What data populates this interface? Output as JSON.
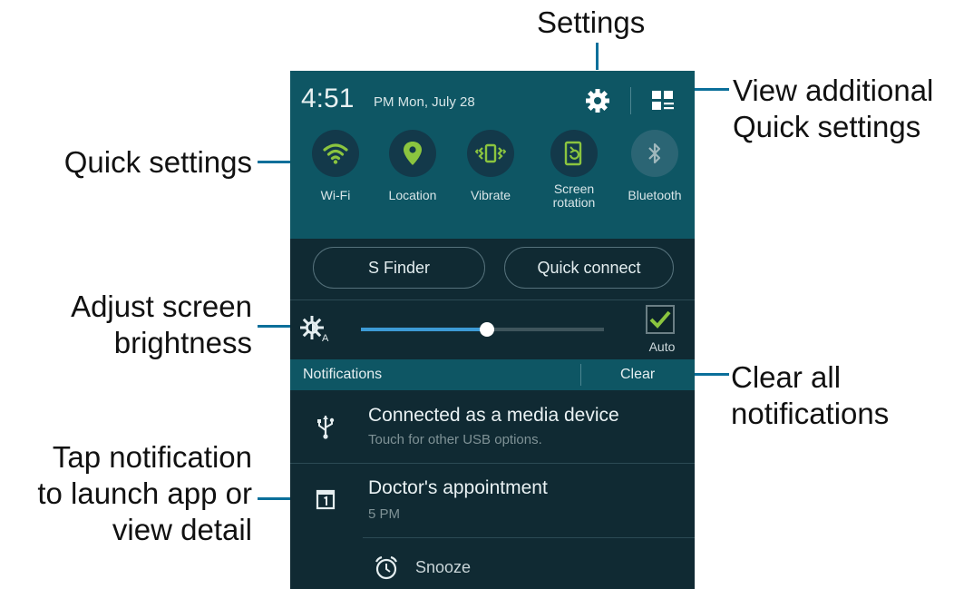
{
  "callouts": {
    "settings": "Settings",
    "view_additional_line1": "View additional",
    "view_additional_line2": "Quick settings",
    "quick_settings": "Quick settings",
    "adjust_line1": "Adjust screen",
    "adjust_line2": "brightness",
    "clear_line1": "Clear all",
    "clear_line2": "notifications",
    "tap_line1": "Tap notification",
    "tap_line2": "to launch app or",
    "tap_line3": "view detail"
  },
  "status": {
    "time": "4:51",
    "date": "PM  Mon, July 28"
  },
  "quick_settings": [
    {
      "label": "Wi-Fi",
      "icon": "wifi-icon",
      "active": true
    },
    {
      "label": "Location",
      "icon": "location-icon",
      "active": true
    },
    {
      "label": "Vibrate",
      "icon": "vibrate-icon",
      "active": true
    },
    {
      "label": "Screen",
      "label2": "rotation",
      "icon": "screen-rotation-icon",
      "active": true
    },
    {
      "label": "Bluetooth",
      "icon": "bluetooth-icon",
      "active": false
    }
  ],
  "buttons": {
    "s_finder": "S Finder",
    "quick_connect": "Quick connect"
  },
  "brightness": {
    "level_percent": 52,
    "auto_label": "Auto",
    "auto_checked": true
  },
  "notifications": {
    "header": "Notifications",
    "clear": "Clear",
    "items": [
      {
        "title": "Connected as a media device",
        "subtitle": "Touch for other USB options.",
        "icon": "usb-icon"
      },
      {
        "title": "Doctor's appointment",
        "subtitle": "5 PM",
        "icon": "calendar-icon",
        "action": "Snooze"
      }
    ]
  },
  "colors": {
    "accent_green": "#8bc53f",
    "panel_teal": "#0e5664",
    "dark_bg": "#102a33",
    "callout_line": "#0b6f9a"
  }
}
